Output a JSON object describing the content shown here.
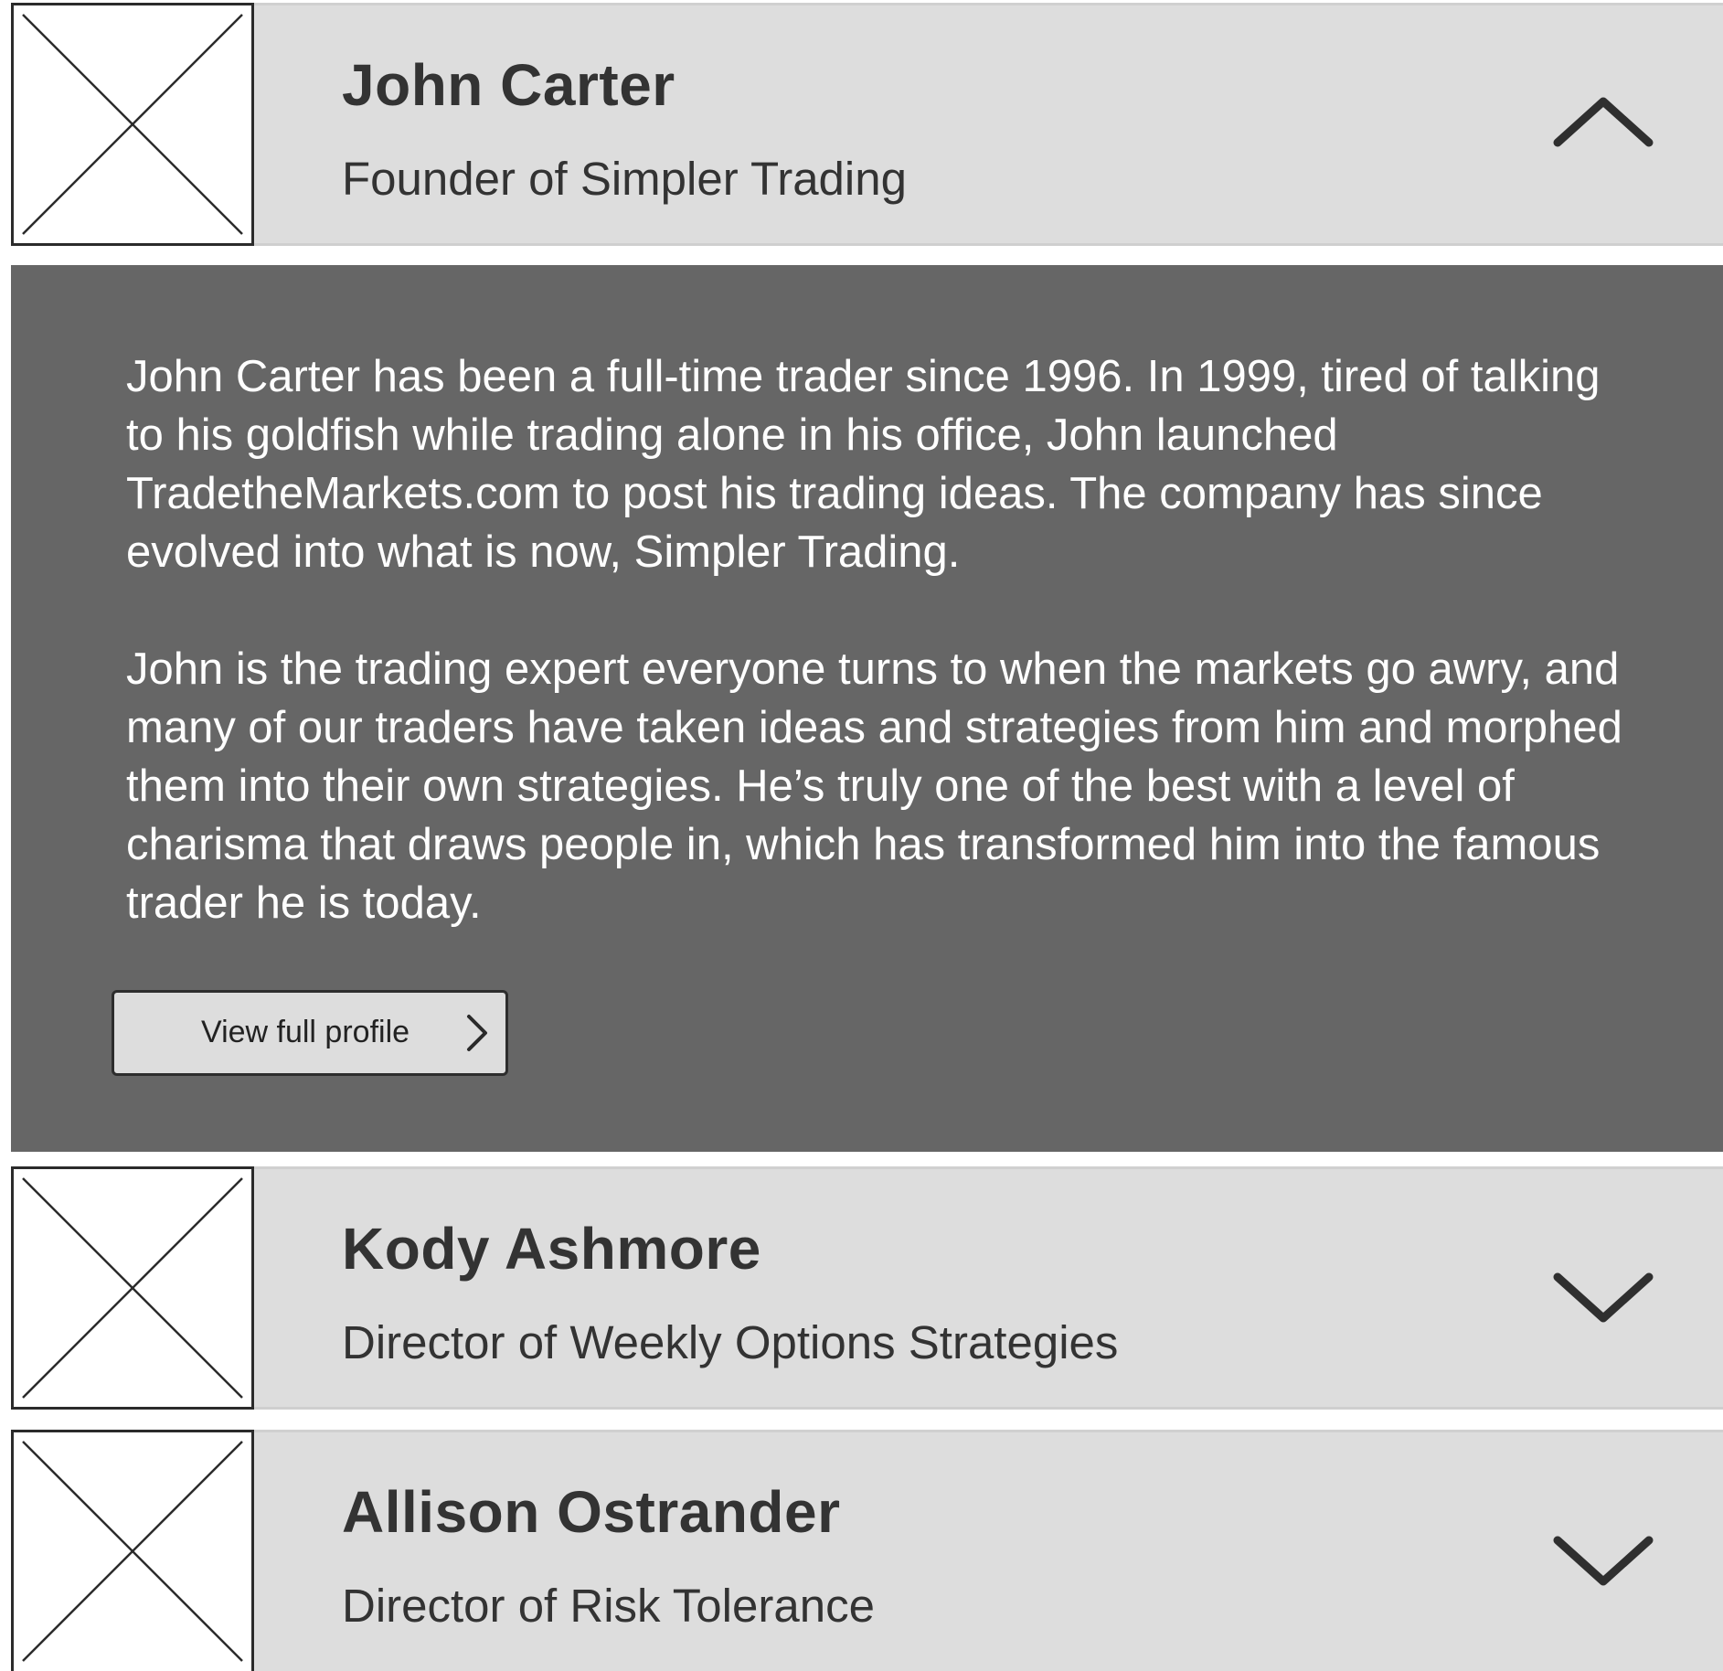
{
  "people": [
    {
      "name": "John Carter",
      "title": "Founder of Simpler Trading",
      "expanded": true
    },
    {
      "name": "Kody Ashmore",
      "title": "Director of Weekly Options Strategies",
      "expanded": false
    },
    {
      "name": "Allison Ostrander",
      "title": "Director of Risk Tolerance",
      "expanded": false
    }
  ],
  "expanded_panel": {
    "bio_paragraphs": [
      "John Carter has been a full-time trader since 1996. In 1999, tired of talking to his goldfish while trading alone in his office, John launched TradetheMarkets.com to post his trading ideas. The company has since evolved into what is now, Simpler Trading.",
      "John is the trading expert everyone turns to when the markets go awry, and many of our traders have taken ideas and strategies from him and morphed them into their own strategies. He’s truly one of the best with a level of charisma that draws people in, which has transformed him into the famous trader he is today."
    ],
    "profile_button_label": "View full profile"
  },
  "icons": {
    "expanded": "chevron-up-icon",
    "collapsed": "chevron-down-icon",
    "button": "chevron-right-icon",
    "avatar": "image-placeholder-icon"
  },
  "colors": {
    "header_background": "#dddddd",
    "panel_background": "#666666",
    "text_dark": "#333333",
    "text_light": "#ffffff"
  }
}
